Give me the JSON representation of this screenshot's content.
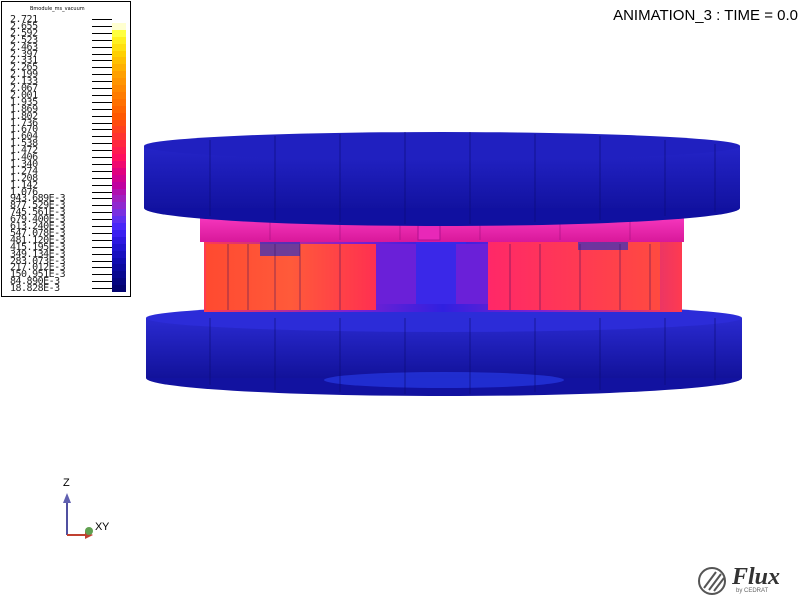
{
  "title": "ANIMATION_3 : TIME = 0.0",
  "legend": {
    "title": "Bmodule_ms_vacuum",
    "side_label": "",
    "values": [
      "2.721",
      "2.655",
      "2.592",
      "2.523",
      "2.463",
      "2.397",
      "2.331",
      "2.265",
      "2.199",
      "2.133",
      "2.067",
      "2.001",
      "1.935",
      "1.869",
      "1.802",
      "1.736",
      "1.670",
      "1.604",
      "1.538",
      "1.472",
      "1.406",
      "1.340",
      "1.274",
      "1.208",
      "1.142",
      "1.076",
      "943.689E-3",
      "877.529E-3",
      "745.561E-3",
      "679.400E-3",
      "613.240E-3",
      "547.078E-3",
      "481.120E-3",
      "415.195E-3",
      "349.134E-3",
      "283.073E-3",
      "217.012E-3",
      "150.951E-3",
      "84.890E-3",
      "18.828E-3"
    ],
    "colors": [
      "#ffffff",
      "#ffffd0",
      "#ffff40",
      "#fff020",
      "#ffe010",
      "#ffd000",
      "#ffc000",
      "#ffb000",
      "#ffa000",
      "#ff9400",
      "#ff8800",
      "#ff7c00",
      "#ff7000",
      "#ff6400",
      "#ff5800",
      "#ff4c10",
      "#ff4020",
      "#ff3430",
      "#ff2840",
      "#ff1c50",
      "#ff1060",
      "#f00870",
      "#e00080",
      "#d00090",
      "#c000a0",
      "#b010b0",
      "#a020c0",
      "#9028d0",
      "#7a30e0",
      "#6030f0",
      "#4a28f8",
      "#3a20f0",
      "#2c18e0",
      "#2014d0",
      "#1810c0",
      "#100cb0",
      "#0c0aa0",
      "#080890",
      "#060680",
      "#040470"
    ]
  },
  "axis": {
    "z": "Z",
    "x": "X",
    "y": "Y"
  },
  "logo": {
    "word": "Flux",
    "sub": "by CEDRAT"
  },
  "colors": {
    "disk_top": "#1e1eb4",
    "disk_edge": "#14148c",
    "ring": "#e0209c",
    "ring_top": "#ff40c8",
    "magnet_hot": "#ff4a3a",
    "magnet_mid": "#ff2868",
    "magnet_cool": "#7a20d0"
  }
}
